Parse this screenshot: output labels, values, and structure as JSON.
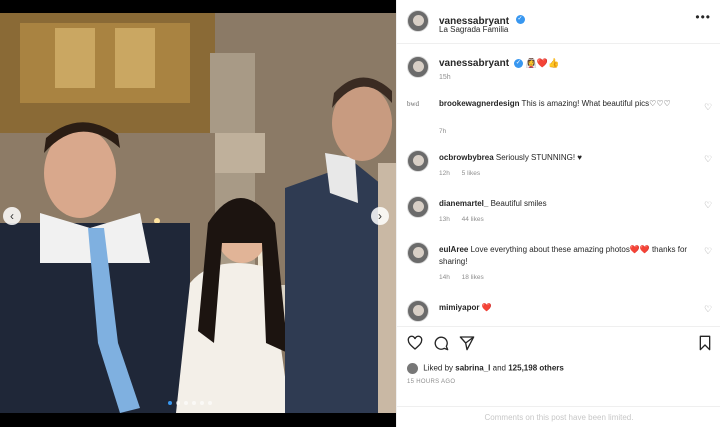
{
  "post": {
    "author": "vanessabryant",
    "location": "La Sagrada Familia",
    "more": "•••"
  },
  "caption": {
    "username": "vanessabryant",
    "emojis": "👰‍♀️❤️👍",
    "time": "15h"
  },
  "comments": [
    {
      "username": "brookewagnerdesign",
      "text": "This is amazing! What beautiful pics♡♡♡",
      "time": "7h",
      "likes": "",
      "avatar_label": "bwd"
    },
    {
      "username": "ocbrowbybrea",
      "text": "Seriously STUNNING! ♥",
      "time": "12h",
      "likes": "5 likes"
    },
    {
      "username": "dianemartel_",
      "text": "Beautiful smiles",
      "time": "13h",
      "likes": "44 likes"
    },
    {
      "username": "eulAree",
      "text": "Love everything about these amazing photos❤️❤️ thanks for sharing!",
      "time": "14h",
      "likes": "18 likes"
    },
    {
      "username": "mimiyapor",
      "text": "❤️",
      "time": "",
      "likes": ""
    }
  ],
  "actions": {
    "like_icon": "heart-outline-icon",
    "comment_icon": "comment-bubble-icon",
    "share_icon": "paper-plane-icon",
    "save_icon": "bookmark-icon"
  },
  "likes": {
    "prefix": "Liked by",
    "first_user": "sabrina_l",
    "connector": "and",
    "others": "125,198 others"
  },
  "time_ago": "15 HOURS AGO",
  "comments_disabled": "Comments on this post have been limited.",
  "colors": {
    "verified": "#3897f0",
    "text": "#262626",
    "secondary": "#8e8e8e",
    "heart_red": "#ed4956"
  },
  "photo": {
    "prev_icon": "chevron-left-icon",
    "next_icon": "chevron-right-icon"
  }
}
